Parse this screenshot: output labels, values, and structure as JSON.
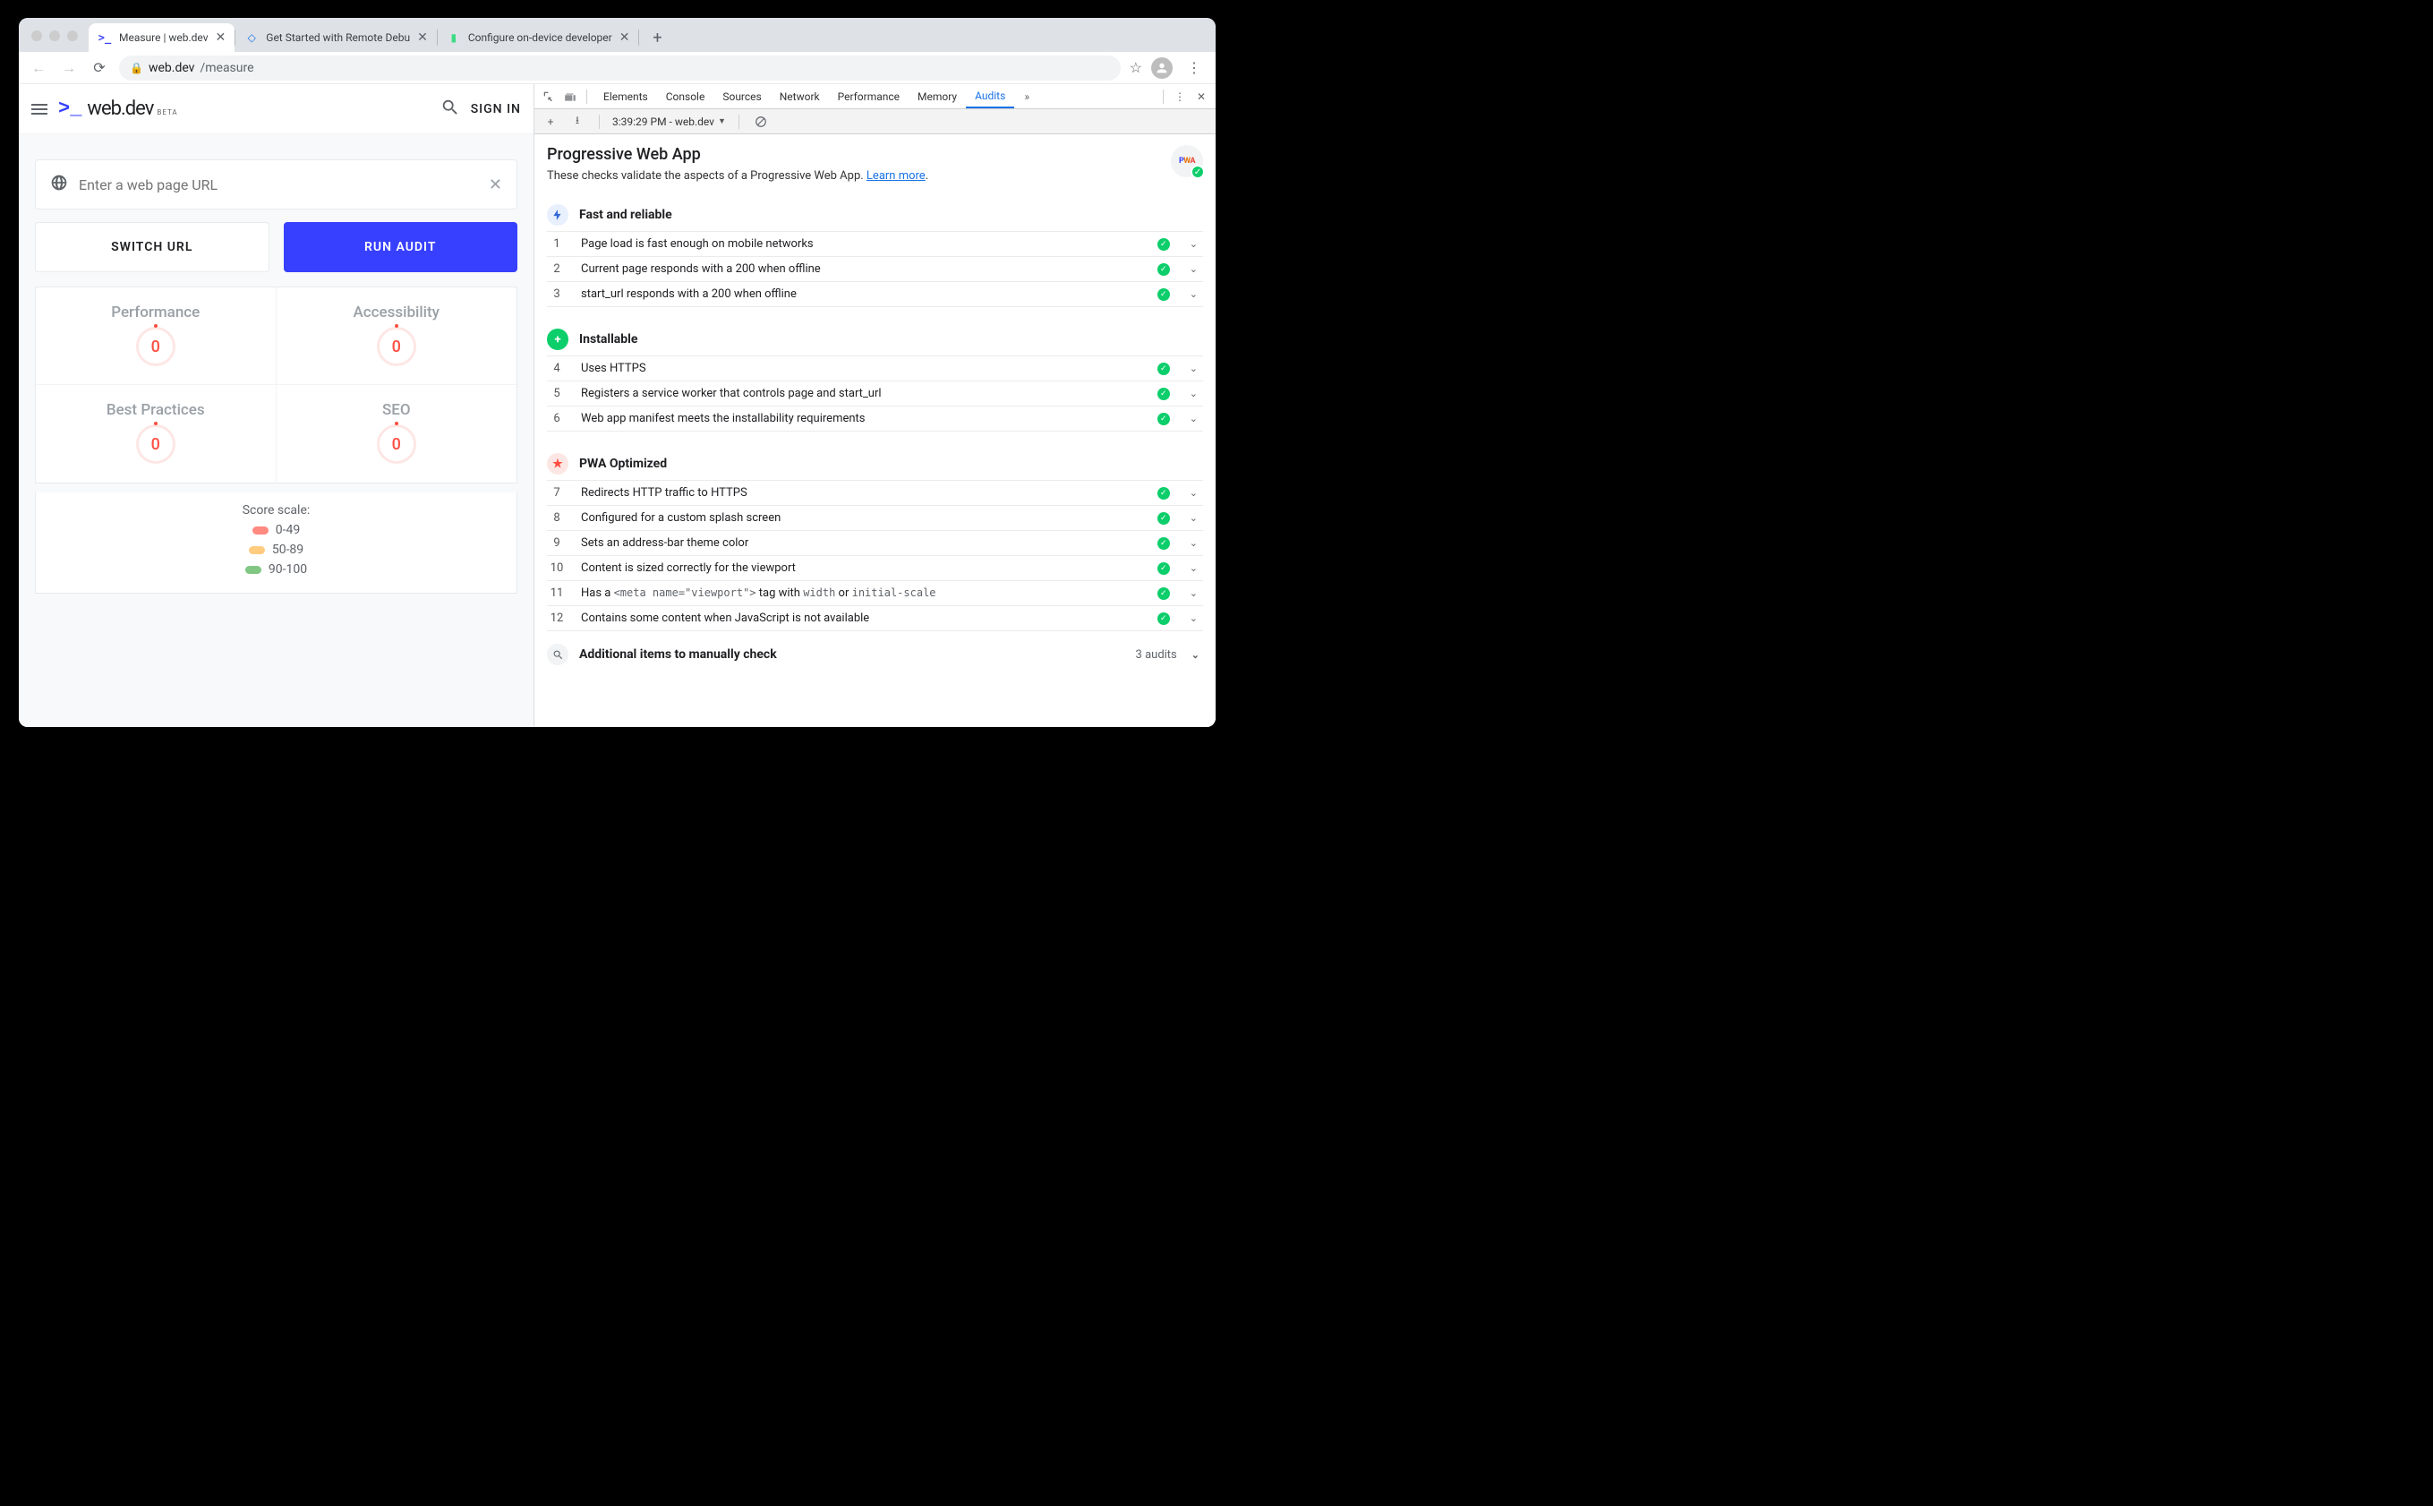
{
  "browser": {
    "tabs": [
      {
        "title": "Measure  |  web.dev",
        "active": true
      },
      {
        "title": "Get Started with Remote Debu",
        "active": false
      },
      {
        "title": "Configure on-device developer",
        "active": false
      }
    ],
    "url_host": "web.dev",
    "url_path": "/measure"
  },
  "page": {
    "logo": "web.dev",
    "logo_badge": "BETA",
    "signin": "SIGN IN",
    "url_placeholder": "Enter a web page URL",
    "switch_btn": "SWITCH URL",
    "run_btn": "RUN AUDIT",
    "scores": [
      {
        "label": "Performance",
        "value": "0"
      },
      {
        "label": "Accessibility",
        "value": "0"
      },
      {
        "label": "Best Practices",
        "value": "0"
      },
      {
        "label": "SEO",
        "value": "0"
      }
    ],
    "legend_title": "Score scale:",
    "legend": [
      "0-49",
      "50-89",
      "90-100"
    ]
  },
  "devtools": {
    "tabs": [
      "Elements",
      "Console",
      "Sources",
      "Network",
      "Performance",
      "Memory",
      "Audits"
    ],
    "active_tab": "Audits",
    "report_selector": "3:39:29 PM - web.dev",
    "title": "Progressive Web App",
    "desc_pre": "These checks validate the aspects of a Progressive Web App. ",
    "desc_link": "Learn more",
    "desc_post": ".",
    "sections": [
      {
        "title": "Fast and reliable",
        "icon": "bolt",
        "items": [
          {
            "n": "1",
            "t": "Page load is fast enough on mobile networks"
          },
          {
            "n": "2",
            "t": "Current page responds with a 200 when offline"
          },
          {
            "n": "3",
            "t": "start_url responds with a 200 when offline"
          }
        ]
      },
      {
        "title": "Installable",
        "icon": "plus",
        "items": [
          {
            "n": "4",
            "t": "Uses HTTPS"
          },
          {
            "n": "5",
            "t": "Registers a service worker that controls page and start_url"
          },
          {
            "n": "6",
            "t": "Web app manifest meets the installability requirements"
          }
        ]
      },
      {
        "title": "PWA Optimized",
        "icon": "star",
        "items": [
          {
            "n": "7",
            "t": "Redirects HTTP traffic to HTTPS"
          },
          {
            "n": "8",
            "t": "Configured for a custom splash screen"
          },
          {
            "n": "9",
            "t": "Sets an address-bar theme color"
          },
          {
            "n": "10",
            "t": "Content is sized correctly for the viewport"
          },
          {
            "n": "11",
            "html": "Has a <code>&lt;meta name=\"viewport\"&gt;</code> tag with <code>width</code> or <code>initial-scale</code>"
          },
          {
            "n": "12",
            "t": "Contains some content when JavaScript is not available"
          }
        ]
      }
    ],
    "manual_title": "Additional items to manually check",
    "manual_count": "3 audits"
  }
}
